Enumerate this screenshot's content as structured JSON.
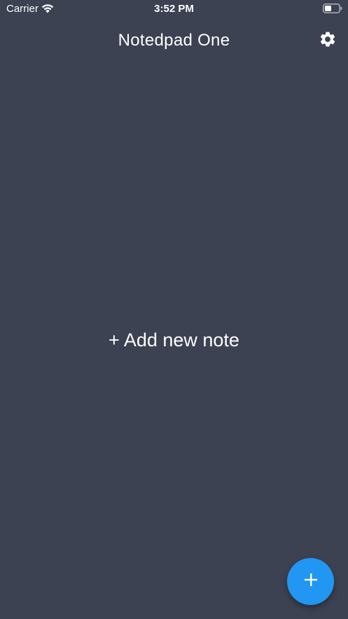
{
  "status_bar": {
    "carrier": "Carrier",
    "time": "3:52 PM",
    "wifi_icon": "wifi-icon",
    "battery_icon": "battery-icon"
  },
  "app_bar": {
    "title": "Notedpad One",
    "settings_icon": "gear-icon"
  },
  "main": {
    "empty_state_label": "+ Add new note"
  },
  "fab": {
    "icon": "plus-icon"
  },
  "colors": {
    "background": "#3c4252",
    "accent": "#2196f3",
    "text": "#ffffff"
  }
}
